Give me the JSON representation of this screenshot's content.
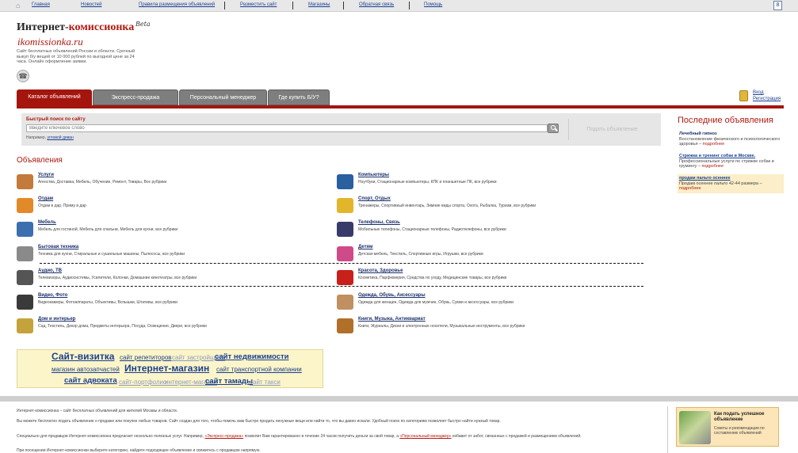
{
  "topbar": {
    "links": [
      "Главная",
      "Новостей",
      "Правила размещения объявлений",
      "Разместить сайт",
      "Магазины",
      "Обратная связь",
      "Помощь"
    ],
    "badge": "8"
  },
  "header": {
    "title_black": "Интернет-",
    "title_red": "комиссионка",
    "beta": "Beta",
    "domain": "ikomissionka.ru",
    "description": "Сайт бесплатных объявлений России и области. Срочный выкуп б/у вещей от 10 000 рублей по выгодной цене за 24 часа. Онлайн оформление заявки."
  },
  "login": {
    "link": "Вход",
    "register": "Регистрация"
  },
  "tabs": [
    "Каталог объявлений",
    "Экспресс-продажа",
    "Персональный менеджер",
    "Где купить Б/У?"
  ],
  "search": {
    "label": "Быстрый поиск по сайту",
    "placeholder": "Введите ключевое слово",
    "example_prefix": "Например,",
    "example_link": "угловой диван",
    "post_ad": "Подать объявление"
  },
  "ads_heading": "Объявления",
  "categories_left": [
    {
      "title": "Услуги",
      "sub": "Агенства, Доставка, Мебель, Обучение, Ремонт, Товары, Все рубрики",
      "icon": "handshake-icon",
      "color": "#c47a3a"
    },
    {
      "title": "Отдам",
      "sub": "Отдам в дар, Приму в дар",
      "icon": "gift-icon",
      "color": "#e28a2a"
    },
    {
      "title": "Мебель",
      "sub": "Мебель для гостиной, Мебель для спальни, Мебель для кухни, все рубрики",
      "icon": "furniture-icon",
      "color": "#3b6fb0"
    },
    {
      "title": "Бытовая техника",
      "sub": "Техника для кухни, Стиральные и сушильные машины, Пылесосы, все рубрики",
      "icon": "appliance-icon",
      "color": "#8a8a8a"
    },
    {
      "title": "Аудио, ТВ",
      "sub": "Телевизоры, Аудиосистемы, Усилители, Колонки, Домашние кинотеатры, все рубрики",
      "icon": "tv-icon",
      "color": "#555555"
    },
    {
      "title": "Видео, Фото",
      "sub": "Видеокамеры, Фотоаппараты, Объективы, Вспышки, Штативы, все рубрики",
      "icon": "camera-icon",
      "color": "#3a3a3a"
    },
    {
      "title": "Дом и интерьер",
      "sub": "Сад, Текстиль, Декор дома, Предметы интерьера, Посуда, Освещение, Двери, все рубрики",
      "icon": "plant-icon",
      "color": "#c4a43a"
    }
  ],
  "categories_right": [
    {
      "title": "Компьютеры",
      "sub": "Ноутбуки, Стационарные компьютеры, КПК и планшетные ПК, все рубрики",
      "icon": "computer-icon",
      "color": "#2a5fa0"
    },
    {
      "title": "Спорт, Отдых",
      "sub": "Тренажеры, Спортивный инвентарь, Зимние виды спорта, Охота, Рыбалка, Туризм, все рубрики",
      "icon": "sport-icon",
      "color": "#e2b62a"
    },
    {
      "title": "Телефоны, Связь",
      "sub": "Мобильные телефоны, Стационарные телефоны, Радиотелефоны, все рубрики",
      "icon": "phone-icon",
      "color": "#3a3a6a"
    },
    {
      "title": "Детям",
      "sub": "Детская мебель, Текстиль, Спортивные игры, Игрушки, все рубрики",
      "icon": "toys-icon",
      "color": "#d04a8a"
    },
    {
      "title": "Красота, Здоровье",
      "sub": "Косметика, Парфюмерия, Средства по уходу, Медицинские товары, все рубрики",
      "icon": "apple-icon",
      "color": "#c8201a"
    },
    {
      "title": "Одежда, Обувь, Аксессуары",
      "sub": "Одежда для женщин, Одежда для мужчин, Обувь, Сумки и аксессуары, все рубрики",
      "icon": "clothes-icon",
      "color": "#c09060"
    },
    {
      "title": "Книги, Музыка, Антиквариат",
      "sub": "Книги, Журналы, Диски и электронные носители, Музыкальные инструменты, все рубрики",
      "icon": "violin-icon",
      "color": "#b0702a"
    }
  ],
  "all_rubrics": "все рубрики",
  "sites": [
    {
      "text": "Сайт-визитка",
      "big": true
    },
    {
      "text": "сайт репетиторов",
      "big": false
    },
    {
      "text": "сайт застройщика",
      "big": false,
      "faint": true
    },
    {
      "text": "сайт недвижимости",
      "big": true,
      "mid": true
    },
    {
      "text": "магазин автозапчастей",
      "big": false
    },
    {
      "text": "Интернет-магазин",
      "big": true
    },
    {
      "text": "сайт транспортной компании",
      "big": false
    },
    {
      "text": "сайт адвоката",
      "big": false,
      "mid": true
    },
    {
      "text": "сайт-портфолио",
      "big": false,
      "faint": true
    },
    {
      "text": "интернет-магазин",
      "big": false,
      "faint": true
    },
    {
      "text": "сайт тамады",
      "big": false,
      "mid": true
    },
    {
      "text": "сайт такси",
      "big": false,
      "faint": true
    }
  ],
  "latest": {
    "title": "Последние объявления",
    "items": [
      {
        "title": "Лечебный гипноз",
        "text": "Восстановление физического и психологического здоровья – ",
        "more": "подробнее"
      },
      {
        "title": "Стрижка и тренинг собак в Москве.",
        "text": "Профессиональные услуги по стрижке собак и грумингу – ",
        "more": "подробнее"
      },
      {
        "title": "продам пальто осеннее",
        "text": "Продам осеннее пальто 42-44 размера – ",
        "more": "подробнее"
      }
    ]
  },
  "footer": {
    "p1": "Интернет-комиссионка – сайт бесплатных объявлений для жителей Москвы и области.",
    "p2": "Вы можете бесплатно подать объявление о продаже или покупке любых товаров. Сайт создан для того, чтобы помочь вам быстро продать ненужные вещи или найти то, что вы давно искали. Удобный поиск по категориям позволяет быстро найти нужный товар.",
    "p3_a": "Специально для продавцов Интернет-комиссионка предлагает несколько полезных услуг. Например, ",
    "p3_link1": "«Экспресс-продажа»",
    "p3_b": " позволит Вам гарантированно в течение 24 часов получить деньги за свой товар, а ",
    "p3_link2": "«Персональный менеджер»",
    "p3_c": " избавит от забот, связанных с продажей и размещением объявлений.",
    "p4": "При посещении Интернет-комиссионки выберите категорию, найдите подходящее объявление и свяжитесь с продавцом напрямую."
  },
  "promo": {
    "title": "Как подать успешное объявление",
    "text": "Советы и рекомендации по составлению объявлений"
  }
}
